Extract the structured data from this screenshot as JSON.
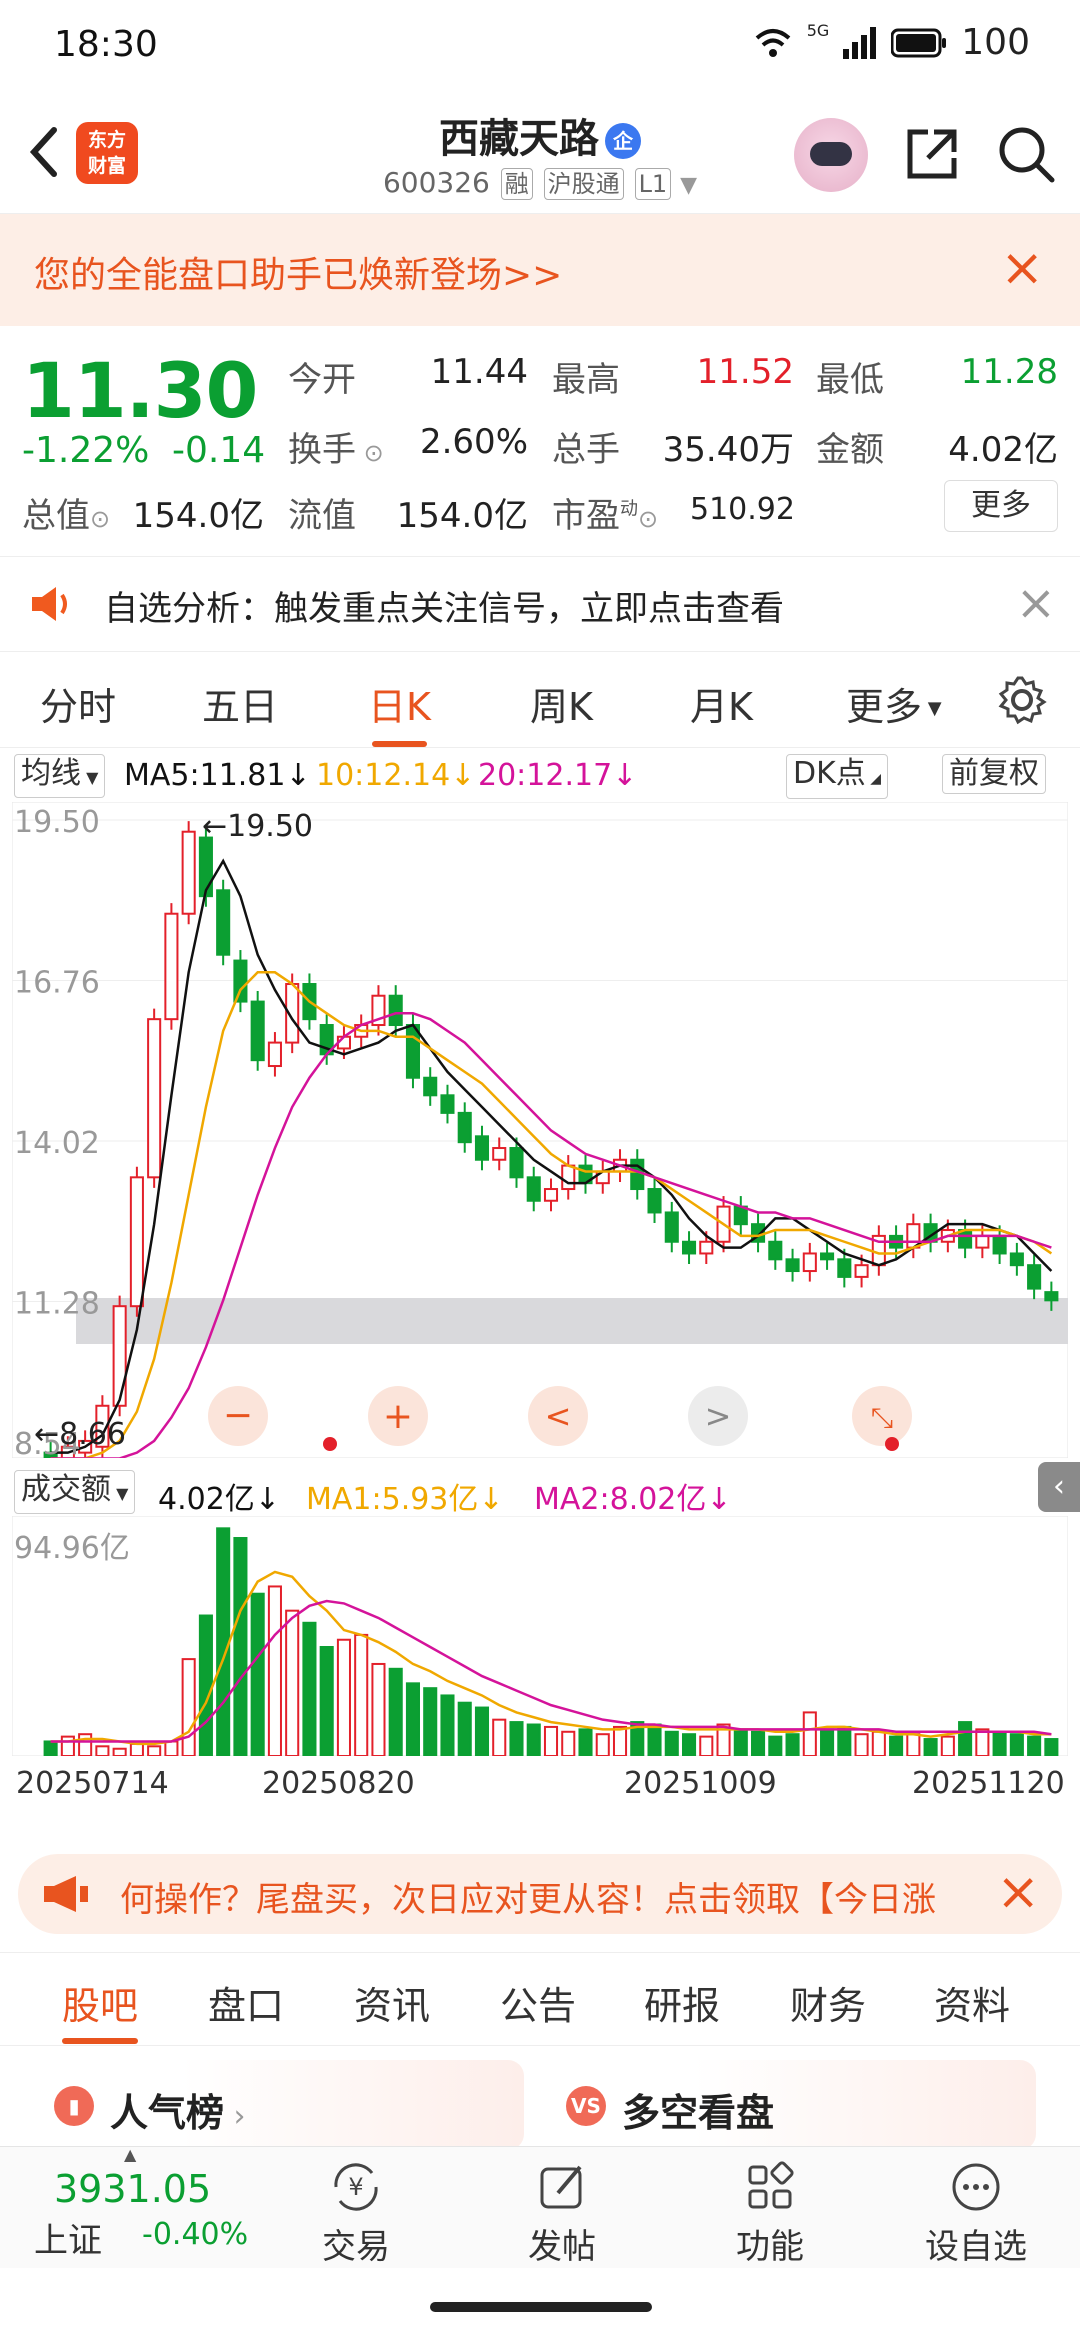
{
  "status": {
    "time": "18:30",
    "network": "5G",
    "battery": "100"
  },
  "header": {
    "logo_text": "东方财富",
    "stock_name": "西藏天路",
    "name_badge": "企",
    "stock_code": "600326",
    "tags": [
      "融",
      "沪股通",
      "L1"
    ]
  },
  "banner": {
    "text": "您的全能盘口助手已焕新登场>>"
  },
  "quote": {
    "price": "11.30",
    "change_pct": "-1.22%",
    "change_abs": "-0.14",
    "open_label": "今开",
    "open": "11.44",
    "high_label": "最高",
    "high": "11.52",
    "low_label": "最低",
    "low": "11.28",
    "turnover_label": "换手",
    "turnover": "2.60%",
    "volume_label": "总手",
    "volume": "35.40万",
    "amount_label": "金额",
    "amount": "4.02亿",
    "mktcap_label": "总值",
    "mktcap": "154.0亿",
    "float_label": "流值",
    "float": "154.0亿",
    "pe_label": "市盈",
    "pe_sup": "动",
    "pe": "510.92",
    "more": "更多"
  },
  "alert": {
    "text": "自选分析：触发重点关注信号，立即点击查看"
  },
  "tabs": [
    "分时",
    "五日",
    "日K",
    "周K",
    "月K",
    "更多"
  ],
  "active_tab": "日K",
  "ma_line": {
    "select": "均线",
    "ma5": "MA5:11.81↓",
    "ma10": "10:12.14↓",
    "ma20": "20:12.17↓",
    "dk": "DK点",
    "adjust": "前复权"
  },
  "colors": {
    "up": "#e3202a",
    "down": "#0b9f32",
    "ma5": "#111111",
    "ma10": "#f0a800",
    "ma20": "#d4139a",
    "accent": "#e8541f"
  },
  "chart_data": [
    {
      "type": "candlestick",
      "y_ticks": [
        "19.50",
        "16.76",
        "14.02",
        "11.28",
        "8.54"
      ],
      "ylim": [
        8.54,
        19.5
      ],
      "annotations": [
        "19.50",
        "8.66"
      ],
      "series": [
        {
          "name": "MA5",
          "values": [
            8.7,
            8.7,
            8.8,
            9.0,
            9.6,
            10.8,
            12.6,
            14.8,
            16.9,
            18.3,
            18.8,
            18.2,
            17.2,
            16.6,
            16.1,
            15.7,
            15.6,
            15.5,
            15.6,
            15.7,
            15.9,
            16.0,
            15.6,
            15.2,
            14.9,
            14.6,
            14.3,
            14.0,
            13.7,
            13.5,
            13.3,
            13.3,
            13.5,
            13.6,
            13.6,
            13.4,
            13.1,
            12.7,
            12.4,
            12.2,
            12.2,
            12.4,
            12.7,
            12.7,
            12.5,
            12.3,
            12.1,
            12.0,
            11.9,
            12.0,
            12.2,
            12.4,
            12.6,
            12.6,
            12.6,
            12.5,
            12.4,
            12.1,
            11.8
          ]
        },
        {
          "name": "MA10",
          "values": [
            8.6,
            8.6,
            8.6,
            8.7,
            8.9,
            9.4,
            10.3,
            11.6,
            13.1,
            14.6,
            15.9,
            16.6,
            16.9,
            16.9,
            16.7,
            16.4,
            16.2,
            16.0,
            15.9,
            15.9,
            15.8,
            15.8,
            15.6,
            15.4,
            15.2,
            15.0,
            14.7,
            14.4,
            14.1,
            13.8,
            13.6,
            13.5,
            13.5,
            13.5,
            13.5,
            13.4,
            13.2,
            13.0,
            12.8,
            12.6,
            12.4,
            12.4,
            12.5,
            12.5,
            12.5,
            12.4,
            12.3,
            12.2,
            12.1,
            12.1,
            12.2,
            12.3,
            12.4,
            12.5,
            12.5,
            12.5,
            12.4,
            12.3,
            12.1
          ]
        },
        {
          "name": "MA20",
          "values": [
            8.6,
            8.6,
            8.6,
            8.6,
            8.6,
            8.7,
            8.9,
            9.3,
            9.8,
            10.5,
            11.3,
            12.2,
            13.1,
            13.9,
            14.6,
            15.1,
            15.5,
            15.8,
            16.0,
            16.1,
            16.2,
            16.2,
            16.1,
            15.9,
            15.7,
            15.4,
            15.1,
            14.8,
            14.5,
            14.2,
            14.0,
            13.8,
            13.7,
            13.6,
            13.5,
            13.4,
            13.3,
            13.2,
            13.1,
            13.0,
            12.9,
            12.8,
            12.8,
            12.7,
            12.7,
            12.6,
            12.5,
            12.4,
            12.3,
            12.3,
            12.3,
            12.3,
            12.4,
            12.4,
            12.4,
            12.4,
            12.4,
            12.3,
            12.2
          ]
        }
      ],
      "candles": [
        [
          8.7,
          8.6
        ],
        [
          8.6,
          8.8
        ],
        [
          8.7,
          8.9
        ],
        [
          8.8,
          9.5
        ],
        [
          9.5,
          11.2
        ],
        [
          11.2,
          13.4
        ],
        [
          13.4,
          16.1
        ],
        [
          16.1,
          17.9
        ],
        [
          17.9,
          19.3
        ],
        [
          19.2,
          18.2
        ],
        [
          18.3,
          17.2
        ],
        [
          17.1,
          16.4
        ],
        [
          16.4,
          15.4
        ],
        [
          15.3,
          15.7
        ],
        [
          15.7,
          16.7
        ],
        [
          16.7,
          16.1
        ],
        [
          16.0,
          15.5
        ],
        [
          15.6,
          15.8
        ],
        [
          15.8,
          16.0
        ],
        [
          16.0,
          16.5
        ],
        [
          16.5,
          16.0
        ],
        [
          16.0,
          15.1
        ],
        [
          15.1,
          14.8
        ],
        [
          14.8,
          14.5
        ],
        [
          14.5,
          14.0
        ],
        [
          14.1,
          13.7
        ],
        [
          13.7,
          13.9
        ],
        [
          13.9,
          13.4
        ],
        [
          13.4,
          13.0
        ],
        [
          13.0,
          13.2
        ],
        [
          13.2,
          13.6
        ],
        [
          13.6,
          13.3
        ],
        [
          13.3,
          13.5
        ],
        [
          13.5,
          13.7
        ],
        [
          13.7,
          13.2
        ],
        [
          13.2,
          12.8
        ],
        [
          12.8,
          12.3
        ],
        [
          12.3,
          12.1
        ],
        [
          12.1,
          12.3
        ],
        [
          12.3,
          12.9
        ],
        [
          12.9,
          12.6
        ],
        [
          12.6,
          12.3
        ],
        [
          12.3,
          12.0
        ],
        [
          12.0,
          11.8
        ],
        [
          11.8,
          12.1
        ],
        [
          12.1,
          12.0
        ],
        [
          12.0,
          11.7
        ],
        [
          11.7,
          11.9
        ],
        [
          11.9,
          12.4
        ],
        [
          12.4,
          12.2
        ],
        [
          12.2,
          12.6
        ],
        [
          12.6,
          12.3
        ],
        [
          12.3,
          12.5
        ],
        [
          12.5,
          12.2
        ],
        [
          12.2,
          12.4
        ],
        [
          12.4,
          12.1
        ],
        [
          12.1,
          11.9
        ],
        [
          11.9,
          11.5
        ],
        [
          11.44,
          11.3
        ]
      ]
    },
    {
      "type": "bar",
      "y_ticks": [
        "94.96亿"
      ],
      "annotations": [
        "4.02亿↓"
      ],
      "values": [
        6,
        8,
        9,
        4,
        3,
        5,
        4,
        6,
        40,
        58,
        94,
        90,
        67,
        70,
        60,
        55,
        45,
        48,
        50,
        38,
        36,
        30,
        28,
        25,
        22,
        20,
        15,
        14,
        13,
        12,
        10,
        11,
        9,
        12,
        14,
        13,
        10,
        9,
        8,
        13,
        11,
        10,
        8,
        9,
        18,
        11,
        12,
        9,
        10,
        8,
        9,
        7,
        8,
        14,
        11,
        10,
        9,
        8,
        7
      ],
      "series": [
        {
          "name": "MA1",
          "values": [
            6,
            6,
            7,
            7,
            6,
            5,
            5,
            6,
            10,
            22,
            40,
            60,
            72,
            76,
            74,
            66,
            60,
            52,
            50,
            47,
            43,
            38,
            35,
            31,
            28,
            25,
            21,
            18,
            16,
            14,
            13,
            12,
            11,
            11,
            12,
            12,
            12,
            11,
            11,
            11,
            11,
            11,
            10,
            10,
            11,
            12,
            12,
            11,
            10,
            9,
            9,
            8,
            9,
            10,
            10,
            10,
            10,
            9,
            9
          ]
        },
        {
          "name": "MA2",
          "values": [
            6,
            6,
            6,
            6,
            6,
            6,
            6,
            6,
            8,
            14,
            22,
            32,
            41,
            50,
            57,
            62,
            64,
            63,
            60,
            57,
            53,
            49,
            45,
            41,
            37,
            33,
            30,
            27,
            24,
            21,
            19,
            17,
            15,
            14,
            13,
            13,
            12,
            12,
            12,
            12,
            11,
            11,
            11,
            11,
            11,
            11,
            11,
            11,
            11,
            10,
            10,
            10,
            10,
            10,
            10,
            10,
            10,
            10,
            9
          ]
        }
      ]
    }
  ],
  "volume_bar": {
    "select": "成交额",
    "value": "4.02亿↓",
    "ma1": "MA1:5.93亿↓",
    "ma2": "MA2:8.02亿↓"
  },
  "dates": [
    "20250714",
    "20250820",
    "20251009",
    "20251120"
  ],
  "ad": {
    "text": "何操作？尾盘买，次日应对更从容！点击领取【今日涨"
  },
  "subtabs": [
    "股吧",
    "盘口",
    "资讯",
    "公告",
    "研报",
    "财务",
    "资料"
  ],
  "cards": [
    {
      "icon": "hot",
      "label": "人气榜"
    },
    {
      "icon": "VS",
      "label": "多空看盘"
    }
  ],
  "bottom_nav": {
    "index_value": "3931.05",
    "index_name": "上证",
    "index_change": "-0.40%",
    "items": [
      "交易",
      "发帖",
      "功能",
      "设自选"
    ]
  }
}
